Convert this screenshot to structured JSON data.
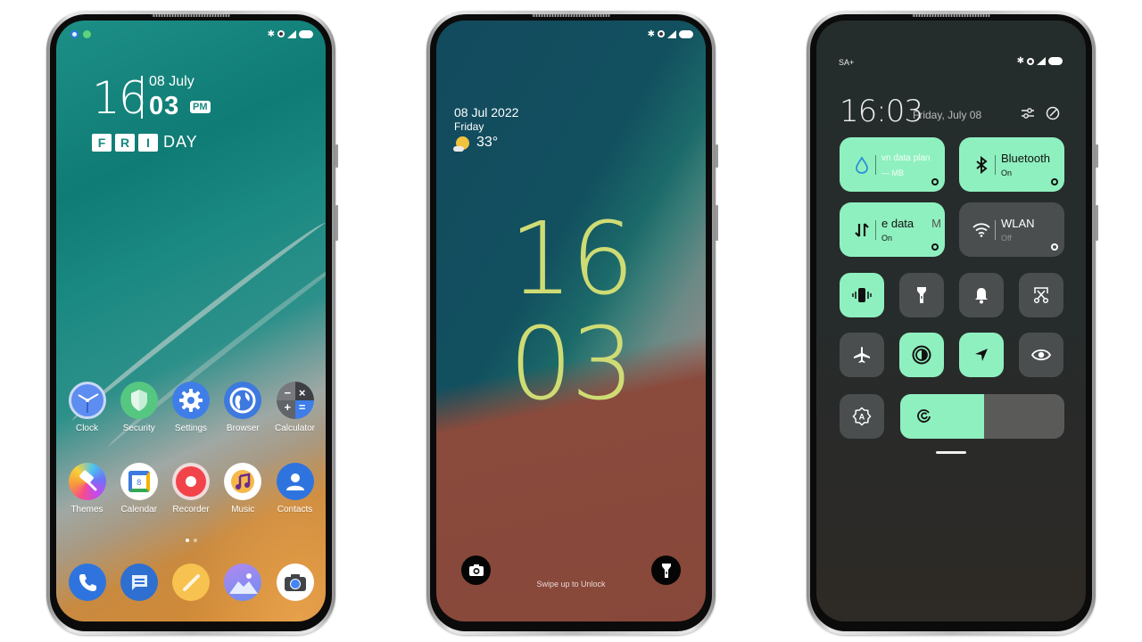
{
  "home_screen": {
    "status_bar": {
      "left_icons": [
        "call-notification-icon",
        "whatsapp-notification-icon"
      ],
      "right_icons": [
        "bluetooth-icon",
        "vpn-icon",
        "signal-icon",
        "battery-icon"
      ]
    },
    "clock_widget": {
      "hour": "16",
      "date": "08 July",
      "minute": "03",
      "ampm": "PM",
      "day_boxed": [
        "F",
        "R",
        "I"
      ],
      "day_rest": "DAY"
    },
    "apps_row1": [
      {
        "label": "Clock",
        "icon": "clock-icon"
      },
      {
        "label": "Security",
        "icon": "shield-icon"
      },
      {
        "label": "Settings",
        "icon": "gear-icon"
      },
      {
        "label": "Browser",
        "icon": "globe-icon"
      },
      {
        "label": "Calculator",
        "icon": "calculator-icon"
      }
    ],
    "apps_row2": [
      {
        "label": "Themes",
        "icon": "paintbrush-icon"
      },
      {
        "label": "Calendar",
        "icon": "calendar-icon",
        "badge": "8"
      },
      {
        "label": "Recorder",
        "icon": "record-icon"
      },
      {
        "label": "Music",
        "icon": "music-note-icon"
      },
      {
        "label": "Contacts",
        "icon": "person-icon"
      }
    ],
    "page_indicator": {
      "pages": 2,
      "current": 1
    },
    "dock": [
      {
        "name": "phone",
        "icon": "phone-icon"
      },
      {
        "name": "messages",
        "icon": "message-icon"
      },
      {
        "name": "notes",
        "icon": "pencil-icon"
      },
      {
        "name": "gallery",
        "icon": "gallery-icon"
      },
      {
        "name": "camera",
        "icon": "camera-icon"
      }
    ]
  },
  "lock_screen": {
    "date": "08 Jul 2022",
    "day": "Friday",
    "temperature": "33°",
    "weather_icon": "partly-sunny-icon",
    "clock_hour": "16",
    "clock_minute": "03",
    "swipe_hint": "Swipe up to Unlock",
    "shortcuts": [
      "camera-icon",
      "flashlight-icon"
    ]
  },
  "control_center": {
    "carrier": "SA+",
    "time": "16:03",
    "date": "Friday, July 08",
    "header_icons": [
      "settings-sliders-icon",
      "edit-icon"
    ],
    "big_tiles": [
      {
        "title": "vn data plan",
        "subtitle": "— MB",
        "icon": "water-drop-icon",
        "state": "on"
      },
      {
        "title": "Bluetooth",
        "subtitle": "On",
        "icon": "bluetooth-icon",
        "state": "on"
      },
      {
        "title": "e data",
        "title_suffix": "M",
        "subtitle": "On",
        "icon": "mobile-data-icon",
        "state": "on"
      },
      {
        "title": "WLAN",
        "subtitle": "Off",
        "icon": "wifi-icon",
        "state": "off"
      }
    ],
    "toggles": [
      {
        "name": "vibrate",
        "icon": "vibrate-icon",
        "state": "on"
      },
      {
        "name": "flashlight",
        "icon": "flashlight-icon",
        "state": "off"
      },
      {
        "name": "ring",
        "icon": "bell-icon",
        "state": "off"
      },
      {
        "name": "screenshot",
        "icon": "screenshot-scissors-icon",
        "state": "off"
      },
      {
        "name": "airplane-mode",
        "icon": "airplane-icon",
        "state": "off"
      },
      {
        "name": "dark-mode",
        "icon": "contrast-icon",
        "state": "on"
      },
      {
        "name": "location",
        "icon": "location-arrow-icon",
        "state": "on"
      },
      {
        "name": "reading-mode",
        "icon": "eye-icon",
        "state": "off"
      }
    ],
    "auto_brightness": {
      "icon": "auto-brightness-icon",
      "state": "off"
    },
    "brightness": {
      "level": 0.51,
      "icon": "brightness-icon"
    }
  },
  "colors": {
    "tile_on": "#8ff0bf",
    "tile_off": "#4a4e4e",
    "lock_clock": "#cfdc74"
  }
}
